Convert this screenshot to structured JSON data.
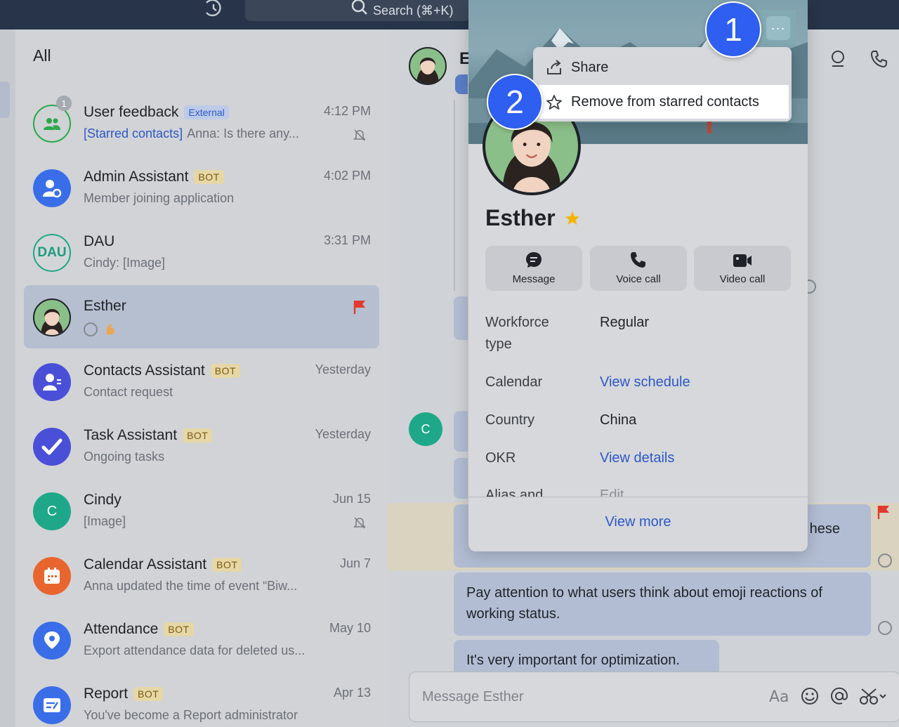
{
  "topbar": {
    "search_placeholder": "Search (⌘+K)"
  },
  "chatlist": {
    "title": "All",
    "items": [
      {
        "name": "User feedback",
        "badge": "External",
        "tag": "[Starred contacts]",
        "preview": "Anna: Is there any...",
        "time": "4:12 PM",
        "unread": "1",
        "muted": true
      },
      {
        "name": "Admin Assistant",
        "badge": "BOT",
        "preview": "Member joining application",
        "time": "4:02 PM"
      },
      {
        "name": "DAU",
        "avatar_text": "DAU",
        "preview": "Cindy: [Image]",
        "time": "3:31 PM"
      },
      {
        "name": "Esther",
        "flagged": true
      },
      {
        "name": "Contacts Assistant",
        "badge": "BOT",
        "preview": "Contact request",
        "time": "Yesterday"
      },
      {
        "name": "Task Assistant",
        "badge": "BOT",
        "preview": "Ongoing tasks",
        "time": "Yesterday"
      },
      {
        "name": "Cindy",
        "avatar_text": "C",
        "preview": "[Image]",
        "time": "Jun 15",
        "muted": true
      },
      {
        "name": "Calendar Assistant",
        "badge": "BOT",
        "preview": "Anna updated the time of event “Biw...",
        "time": "Jun 7"
      },
      {
        "name": "Attendance",
        "badge": "BOT",
        "preview": "Export attendance data for deleted us...",
        "time": "May 10"
      },
      {
        "name": "Report",
        "badge": "BOT",
        "preview": "You've become a Report administrator",
        "time": "Apr 13"
      }
    ]
  },
  "chat": {
    "header_initial": "E",
    "c_avatar": "C",
    "bubble_partial_1": "hese",
    "bubble_2": "Pay attention to what users think about emoji reactions of working status.",
    "bubble_3": "It's very important for optimization.",
    "composer_placeholder": "Message Esther"
  },
  "profile": {
    "name": "Esther",
    "actions": {
      "message": "Message",
      "voice": "Voice call",
      "video": "Video call"
    },
    "info": [
      {
        "label": "Workforce type",
        "value": "Regular"
      },
      {
        "label": "Calendar",
        "value": "View schedule"
      },
      {
        "label": "Country",
        "value": "China"
      },
      {
        "label": "OKR",
        "value": "View details"
      },
      {
        "label": "Alias and",
        "value": "Edit"
      }
    ],
    "view_more": "View more",
    "more_label": "···"
  },
  "menu": {
    "share": "Share",
    "remove_star": "Remove from starred contacts"
  },
  "steps": {
    "one": "1",
    "two": "2"
  },
  "colors": {
    "accent": "#2e58c7",
    "step": "#2f5ff0",
    "flag": "#e03a2f",
    "star": "#f5b400"
  }
}
